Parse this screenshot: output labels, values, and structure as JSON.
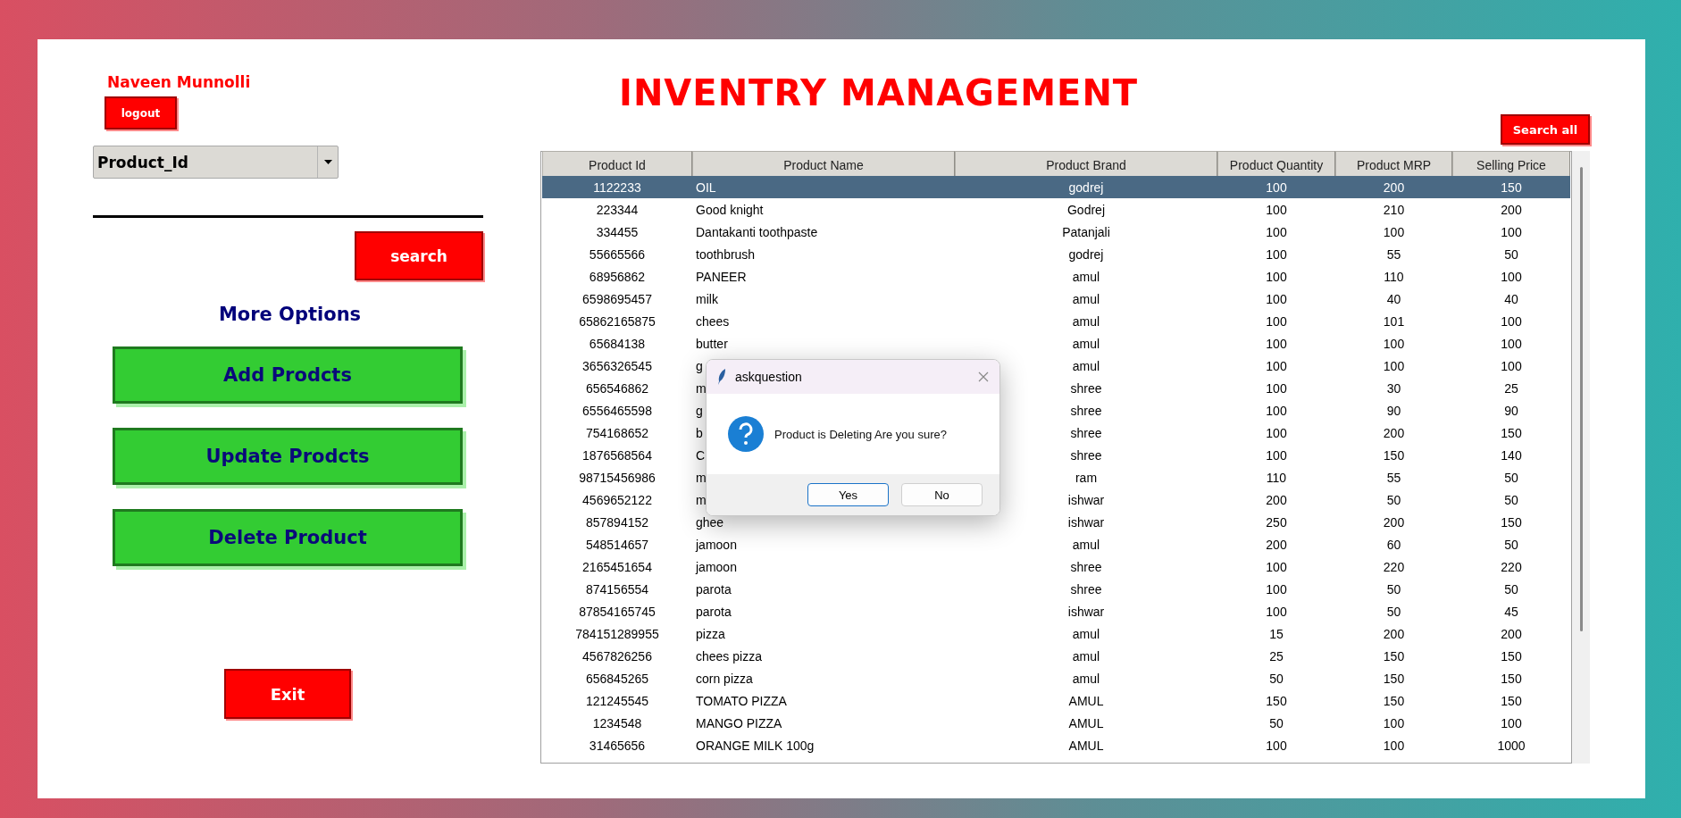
{
  "user": {
    "name": "Naveen Munnolli"
  },
  "logout_button": "logout",
  "title": "INVENTRY MANAGEMENT",
  "search_all_button": "Search all",
  "search_by": {
    "value": "Product_Id"
  },
  "search_button": "search",
  "more_options": {
    "heading": "More Options",
    "buttons": [
      "Add Prodcts",
      "Update Prodcts",
      "Delete Product"
    ]
  },
  "exit_button": "Exit",
  "table": {
    "columns": [
      "Product Id",
      "Product Name",
      "Product Brand",
      "Product Quantity",
      "Product MRP",
      "Selling Price"
    ],
    "rows": [
      {
        "selected": true,
        "cells": [
          "1122233",
          "OIL",
          "godrej",
          "100",
          "200",
          "150"
        ]
      },
      {
        "selected": false,
        "cells": [
          "223344",
          "Good knight",
          "Godrej",
          "100",
          "210",
          "200"
        ]
      },
      {
        "selected": false,
        "cells": [
          "334455",
          "Dantakanti toothpaste",
          "Patanjali",
          "100",
          "100",
          "100"
        ]
      },
      {
        "selected": false,
        "cells": [
          "55665566",
          "toothbrush",
          "godrej",
          "100",
          "55",
          "50"
        ]
      },
      {
        "selected": false,
        "cells": [
          "68956862",
          "PANEER",
          "amul",
          "100",
          "110",
          "100"
        ]
      },
      {
        "selected": false,
        "cells": [
          "6598695457",
          "milk",
          "amul",
          "100",
          "40",
          "40"
        ]
      },
      {
        "selected": false,
        "cells": [
          "65862165875",
          "chees",
          "amul",
          "100",
          "101",
          "100"
        ]
      },
      {
        "selected": false,
        "cells": [
          "65684138",
          "butter",
          "amul",
          "100",
          "100",
          "100"
        ]
      },
      {
        "selected": false,
        "cells": [
          "3656326545",
          "g",
          "amul",
          "100",
          "100",
          "100"
        ]
      },
      {
        "selected": false,
        "cells": [
          "656546862",
          "m",
          "shree",
          "100",
          "30",
          "25"
        ]
      },
      {
        "selected": false,
        "cells": [
          "6556465598",
          "g",
          "shree",
          "100",
          "90",
          "90"
        ]
      },
      {
        "selected": false,
        "cells": [
          "754168652",
          "b",
          "shree",
          "100",
          "200",
          "150"
        ]
      },
      {
        "selected": false,
        "cells": [
          "1876568564",
          "C",
          "shree",
          "100",
          "150",
          "140"
        ]
      },
      {
        "selected": false,
        "cells": [
          "98715456986",
          "m",
          "ram",
          "110",
          "55",
          "50"
        ]
      },
      {
        "selected": false,
        "cells": [
          "4569652122",
          "m",
          "ishwar",
          "200",
          "50",
          "50"
        ]
      },
      {
        "selected": false,
        "cells": [
          "857894152",
          "ghee",
          "ishwar",
          "250",
          "200",
          "150"
        ]
      },
      {
        "selected": false,
        "cells": [
          "548514657",
          "jamoon",
          "amul",
          "200",
          "60",
          "50"
        ]
      },
      {
        "selected": false,
        "cells": [
          "2165451654",
          "jamoon",
          "shree",
          "100",
          "220",
          "220"
        ]
      },
      {
        "selected": false,
        "cells": [
          "874156554",
          "parota",
          "shree",
          "100",
          "50",
          "50"
        ]
      },
      {
        "selected": false,
        "cells": [
          "87854165745",
          "parota",
          "ishwar",
          "100",
          "50",
          "45"
        ]
      },
      {
        "selected": false,
        "cells": [
          "784151289955",
          "pizza",
          "amul",
          "15",
          "200",
          "200"
        ]
      },
      {
        "selected": false,
        "cells": [
          "4567826256",
          "chees pizza",
          "amul",
          "25",
          "150",
          "150"
        ]
      },
      {
        "selected": false,
        "cells": [
          "656845265",
          "corn pizza",
          "amul",
          "50",
          "150",
          "150"
        ]
      },
      {
        "selected": false,
        "cells": [
          "121245545",
          "TOMATO PIZZA",
          "AMUL",
          "150",
          "150",
          "150"
        ]
      },
      {
        "selected": false,
        "cells": [
          "1234548",
          "MANGO PIZZA",
          "AMUL",
          "50",
          "100",
          "100"
        ]
      },
      {
        "selected": false,
        "cells": [
          "31465656",
          "ORANGE MILK 100g",
          "AMUL",
          "100",
          "100",
          "1000"
        ]
      }
    ]
  },
  "dialog": {
    "title": "askquestion",
    "message": "Product is Deleting Are you sure?",
    "buttons": [
      {
        "label": "Yes",
        "default": true
      },
      {
        "label": "No",
        "default": false
      }
    ]
  }
}
